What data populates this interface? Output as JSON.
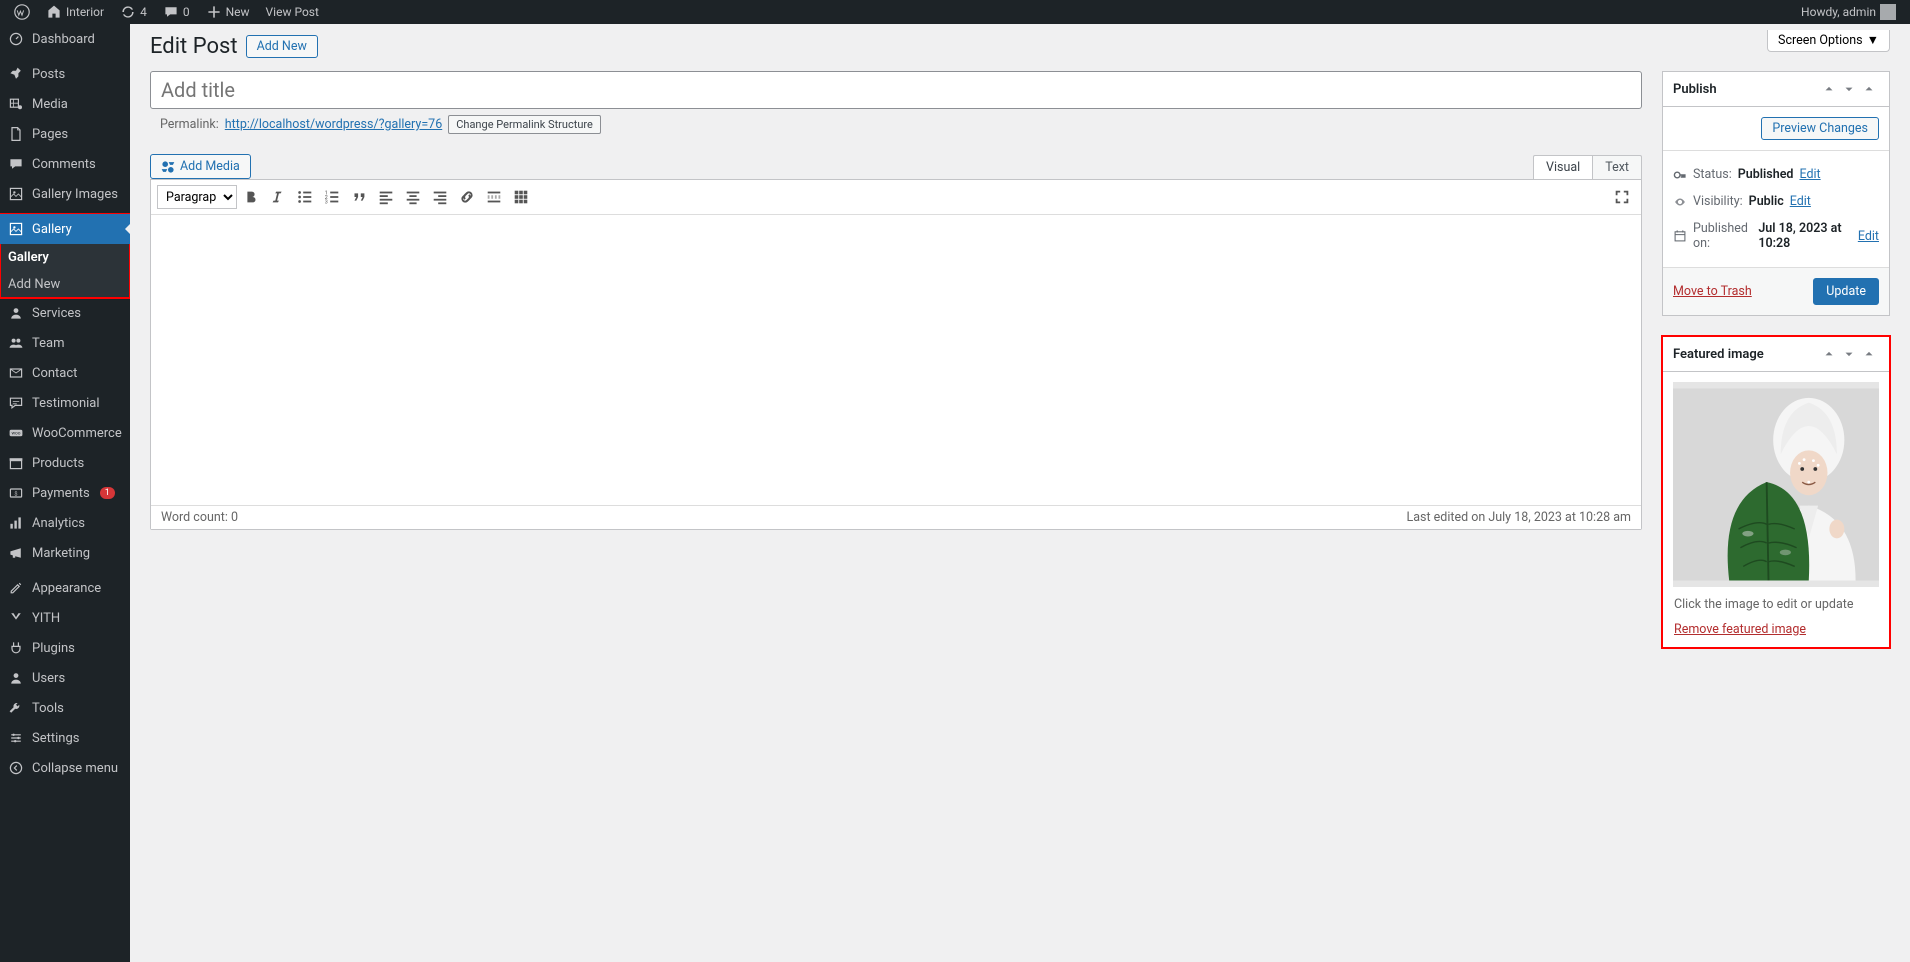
{
  "adminbar": {
    "site_name": "Interior",
    "update_count": 4,
    "comments_count": 0,
    "new_label": "New",
    "view_post_label": "View Post",
    "howdy_label": "Howdy, admin"
  },
  "sidebar": {
    "items": [
      {
        "label": "Dashboard",
        "icon": "dashboard"
      },
      {
        "label": "Posts",
        "icon": "pin"
      },
      {
        "label": "Media",
        "icon": "media"
      },
      {
        "label": "Pages",
        "icon": "page"
      },
      {
        "label": "Comments",
        "icon": "comment"
      },
      {
        "label": "Gallery Images",
        "icon": "gallery"
      },
      {
        "label": "Gallery",
        "icon": "gallery",
        "current": true
      },
      {
        "label": "Services",
        "icon": "user"
      },
      {
        "label": "Team",
        "icon": "team"
      },
      {
        "label": "Contact",
        "icon": "mail"
      },
      {
        "label": "Testimonial",
        "icon": "chat"
      },
      {
        "label": "WooCommerce",
        "icon": "woo"
      },
      {
        "label": "Products",
        "icon": "archive"
      },
      {
        "label": "Payments",
        "icon": "card",
        "badge": "1"
      },
      {
        "label": "Analytics",
        "icon": "chart"
      },
      {
        "label": "Marketing",
        "icon": "bullhorn"
      },
      {
        "label": "Appearance",
        "icon": "brush"
      },
      {
        "label": "YITH",
        "icon": "yith"
      },
      {
        "label": "Plugins",
        "icon": "plug"
      },
      {
        "label": "Users",
        "icon": "user"
      },
      {
        "label": "Tools",
        "icon": "wrench"
      },
      {
        "label": "Settings",
        "icon": "sliders"
      },
      {
        "label": "Collapse menu",
        "icon": "collapse"
      }
    ],
    "submenu": [
      {
        "label": "Gallery",
        "current": true
      },
      {
        "label": "Add New"
      }
    ]
  },
  "screen_options_label": "Screen Options",
  "page": {
    "title": "Edit Post",
    "add_new_label": "Add New"
  },
  "title_placeholder": "Add title",
  "permalink": {
    "label": "Permalink:",
    "url": "http://localhost/wordpress/?gallery=76",
    "change_btn": "Change Permalink Structure"
  },
  "add_media_label": "Add Media",
  "editor_tabs": {
    "visual": "Visual",
    "text": "Text"
  },
  "toolbar": {
    "format": "Paragraph"
  },
  "editor_footer": {
    "word_count_label": "Word count:",
    "word_count": 0,
    "last_edited": "Last edited on July 18, 2023 at 10:28 am"
  },
  "publish": {
    "heading": "Publish",
    "preview_btn": "Preview Changes",
    "status_label": "Status:",
    "status_value": "Published",
    "visibility_label": "Visibility:",
    "visibility_value": "Public",
    "published_label": "Published on:",
    "published_value": "Jul 18, 2023 at 10:28",
    "edit_label": "Edit",
    "trash_label": "Move to Trash",
    "update_btn": "Update"
  },
  "featured": {
    "heading": "Featured image",
    "help_text": "Click the image to edit or update",
    "remove_label": "Remove featured image"
  }
}
